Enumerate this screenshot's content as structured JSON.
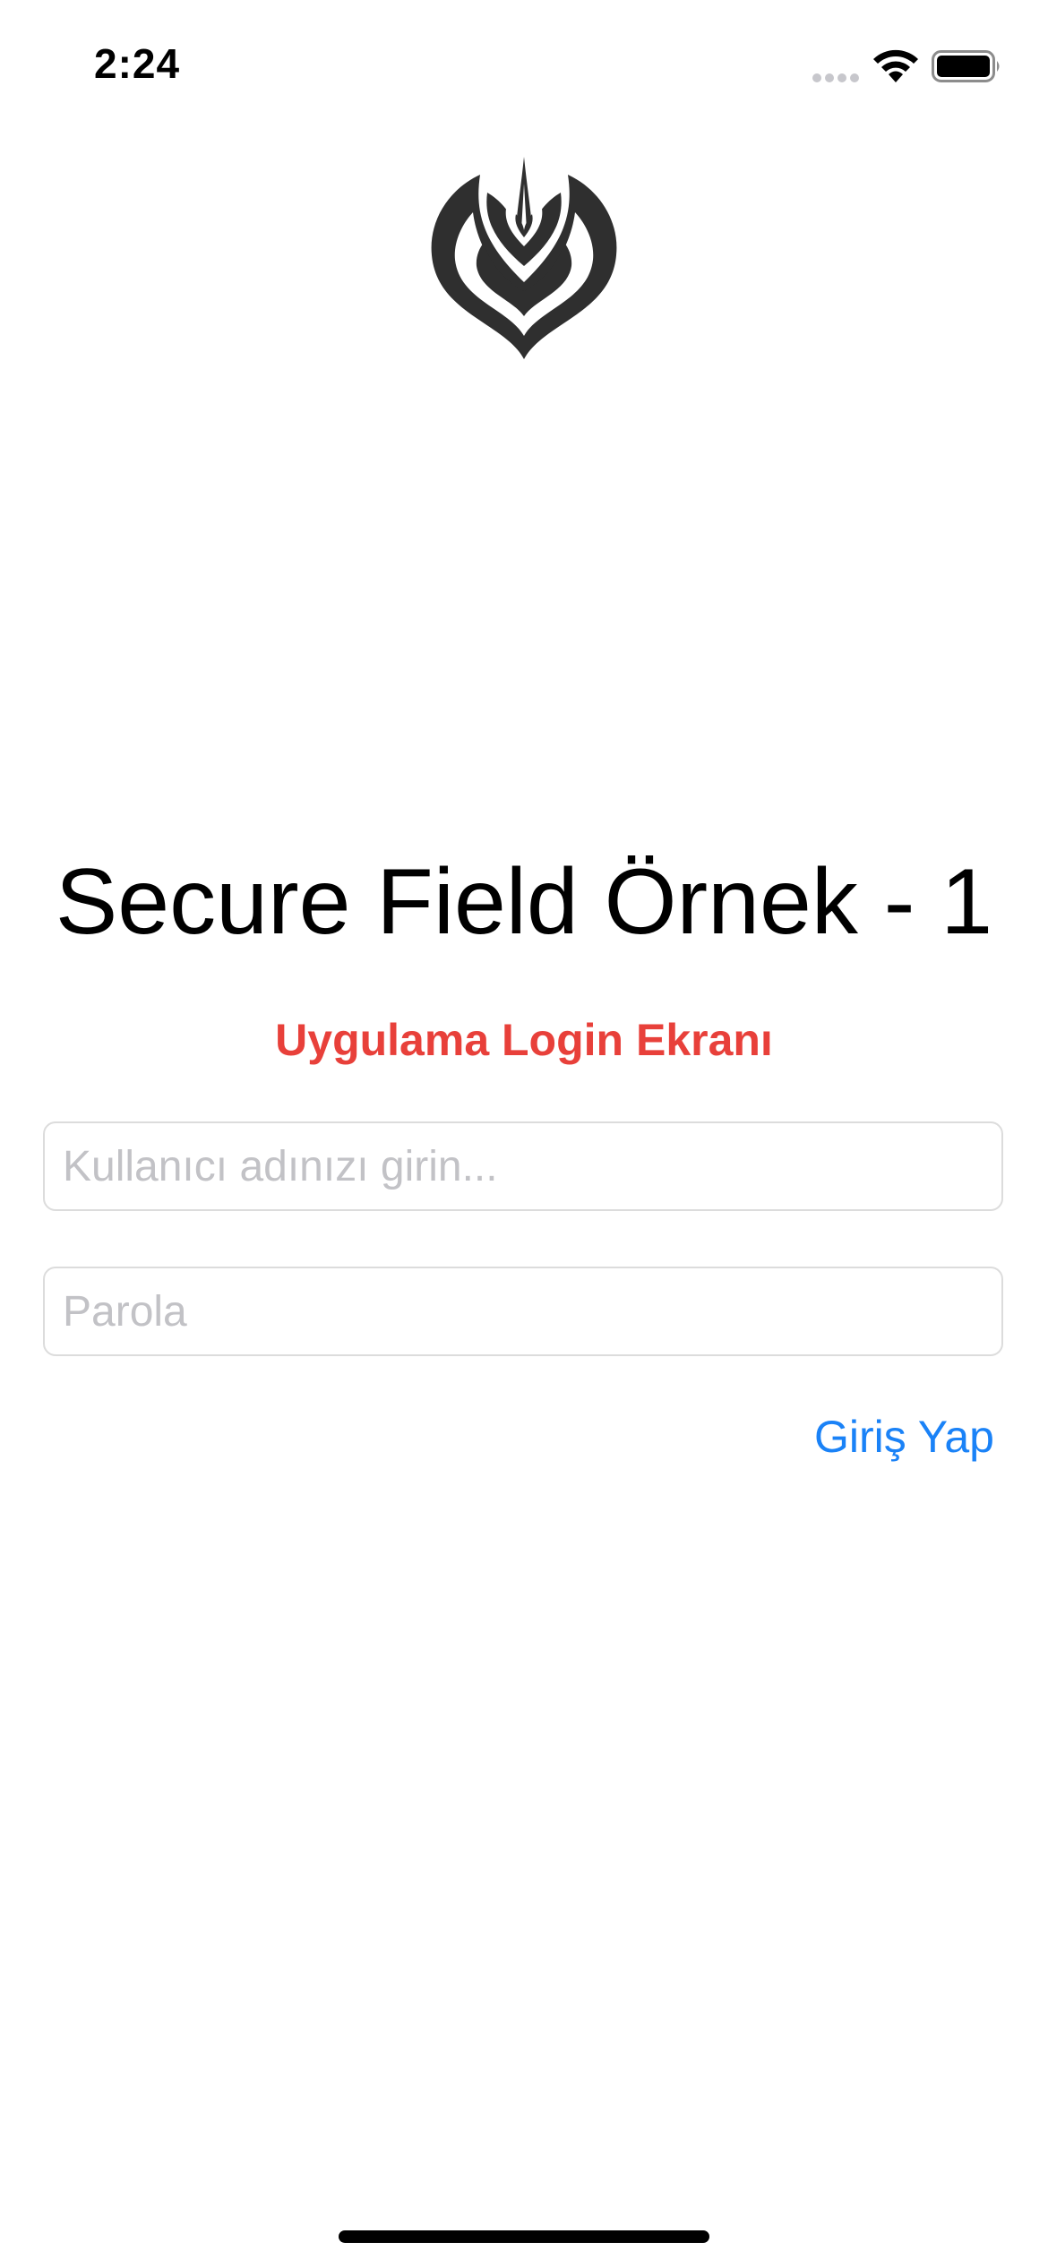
{
  "status_bar": {
    "time": "2:24",
    "icons": [
      "signal-icon",
      "wifi-icon",
      "battery-icon"
    ]
  },
  "logo": {
    "icon": "leaf-logo-icon"
  },
  "title": "Secure Field Örnek - 1",
  "subtitle": "Uygulama Login Ekranı",
  "form": {
    "username": {
      "placeholder": "Kullanıcı adınızı girin...",
      "value": ""
    },
    "password": {
      "placeholder": "Parola",
      "value": ""
    },
    "login_label": "Giriş Yap"
  },
  "colors": {
    "subtitle": "#e8403a",
    "link": "#1a82f7",
    "placeholder": "#c2c2c6",
    "logo": "#2f2f2f"
  }
}
